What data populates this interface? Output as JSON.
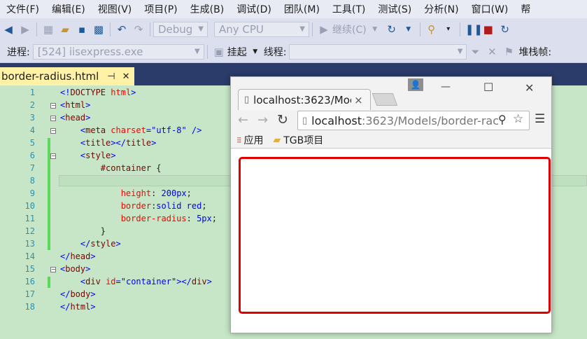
{
  "menu": [
    "文件(F)",
    "编辑(E)",
    "视图(V)",
    "项目(P)",
    "生成(B)",
    "调试(D)",
    "团队(M)",
    "工具(T)",
    "测试(S)",
    "分析(N)",
    "窗口(W)",
    "帮"
  ],
  "toolbar": {
    "config": "Debug",
    "platform": "Any CPU",
    "continue_label": "继续(C)"
  },
  "debugbar": {
    "process_label": "进程:",
    "process_value": "[524] iisexpress.exe",
    "suspend_label": "挂起",
    "thread_label": "线程:",
    "stackframe_label": "堆栈帧:"
  },
  "editor": {
    "tab_title": "border-radius.html",
    "pin_glyph": "⊣",
    "close_glyph": "✕",
    "line_numbers": [
      "1",
      "2",
      "3",
      "4",
      "5",
      "6",
      "7",
      "8",
      "9",
      "10",
      "11",
      "12",
      "13",
      "14",
      "15",
      "16",
      "17",
      "18"
    ]
  },
  "browser": {
    "tab_title": "localhost:3623/Moc",
    "tab_close": "×",
    "url_host": "localhost",
    "url_rest": ":3623/Models/border-rac",
    "bookmark_apps": "应用",
    "bookmark_folder": "TGB项目",
    "window_minimize": "—",
    "window_maximize": "☐",
    "window_close": "✕"
  },
  "colors": {
    "editor_bg": "#c7e6c7",
    "tab_active_bg": "#fff1a6",
    "container_border": "#e00000",
    "vs_chrome": "#dcdfed"
  }
}
